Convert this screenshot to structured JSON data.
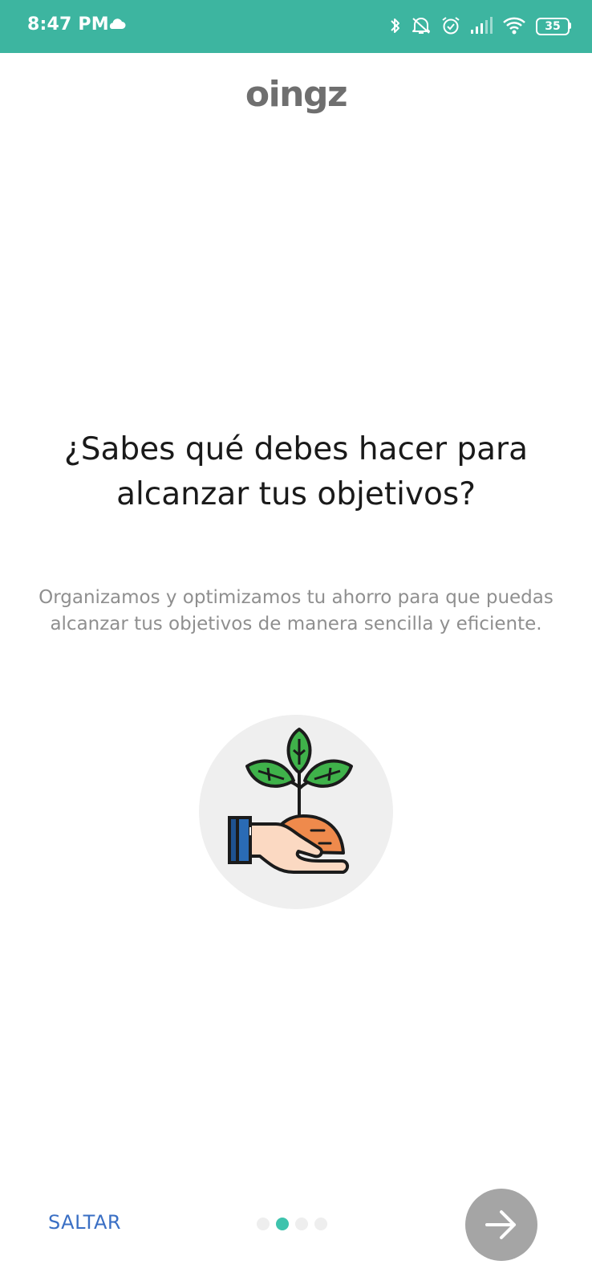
{
  "status_bar": {
    "time": "8:47 PM",
    "battery": "35",
    "background": "#3db5a0",
    "icons": [
      "cloud-icon",
      "bluetooth-icon",
      "mute-icon",
      "alarm-icon",
      "signal-icon",
      "wifi-icon",
      "battery-icon"
    ]
  },
  "app": {
    "logo_text": "oingz",
    "logo_color": "#6f6f6f"
  },
  "onboarding": {
    "title": "¿Sabes qué debes hacer para alcanzar tus objetivos?",
    "description": "Organizamos y optimizamos tu ahorro para que puedas alcanzar tus objetivos de manera sencilla y eficiente.",
    "illustration_icon": "plant-in-hand-icon"
  },
  "navigation": {
    "skip_label": "SALTAR",
    "skip_color": "#3a6fc4",
    "page_count": 4,
    "active_page": 2,
    "active_color": "#3ec3ad",
    "next_icon": "arrow-right-icon"
  }
}
